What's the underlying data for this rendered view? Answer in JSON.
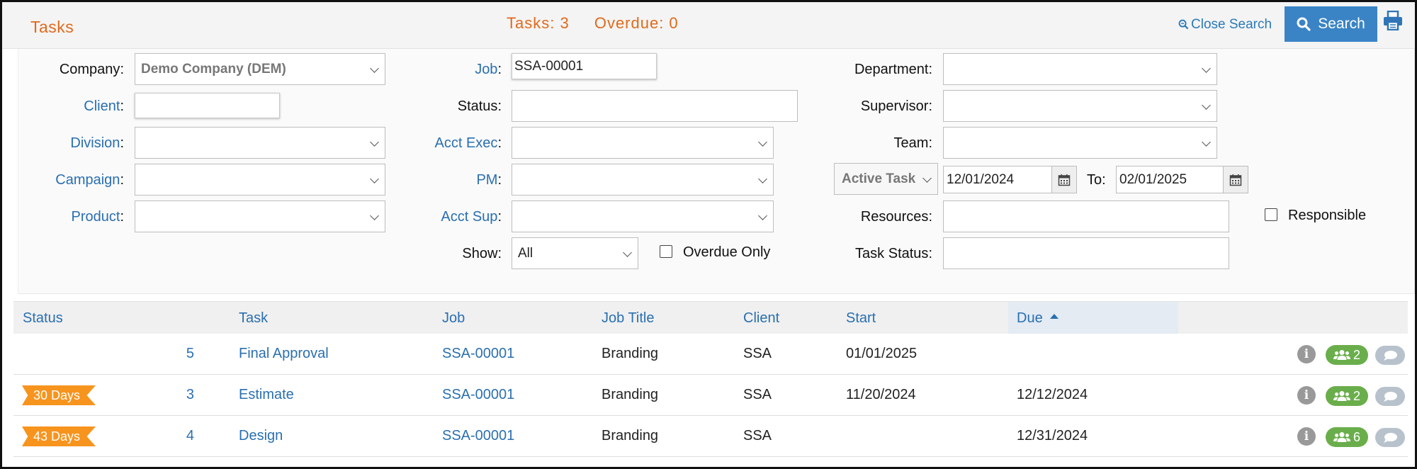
{
  "header": {
    "title": "Tasks",
    "tasks_count": "Tasks: 3",
    "overdue_count": "Overdue: 0",
    "close_search_label": "Close Search",
    "search_label": "Search"
  },
  "form": {
    "company": {
      "label": "Company",
      "value": "Demo Company (DEM)"
    },
    "client": {
      "label": "Client",
      "value": ""
    },
    "division": {
      "label": "Division",
      "value": ""
    },
    "campaign": {
      "label": "Campaign",
      "value": ""
    },
    "product": {
      "label": "Product",
      "value": ""
    },
    "job": {
      "label": "Job",
      "value": "SSA-00001"
    },
    "status": {
      "label": "Status",
      "value": ""
    },
    "acct_exec": {
      "label": "Acct Exec",
      "value": ""
    },
    "pm": {
      "label": "PM",
      "value": ""
    },
    "acct_sup": {
      "label": "Acct Sup",
      "value": ""
    },
    "show": {
      "label": "Show",
      "value": "All"
    },
    "overdue_only": {
      "label": "Overdue Only",
      "checked": false
    },
    "department": {
      "label": "Department",
      "value": ""
    },
    "supervisor": {
      "label": "Supervisor",
      "value": ""
    },
    "team": {
      "label": "Team",
      "value": ""
    },
    "date_type": {
      "value": "Active Task"
    },
    "date_from": {
      "value": "12/01/2024"
    },
    "date_to": {
      "label": "To",
      "value": "02/01/2025"
    },
    "resources": {
      "label": "Resources",
      "value": ""
    },
    "task_status": {
      "label": "Task Status",
      "value": ""
    },
    "responsible": {
      "label": "Responsible",
      "checked": false
    }
  },
  "table": {
    "columns": [
      "Status",
      "Task",
      "Job",
      "Job Title",
      "Client",
      "Start",
      "Due"
    ],
    "sorted_column": "Due",
    "rows": [
      {
        "status_flag": "",
        "number": "5",
        "task": "Final Approval",
        "job": "SSA-00001",
        "job_title": "Branding",
        "client": "SSA",
        "start": "01/01/2025",
        "due": "",
        "team_count": "2"
      },
      {
        "status_flag": "30 Days",
        "number": "3",
        "task": "Estimate",
        "job": "SSA-00001",
        "job_title": "Branding",
        "client": "SSA",
        "start": "11/20/2024",
        "due": "12/12/2024",
        "team_count": "2"
      },
      {
        "status_flag": "43 Days",
        "number": "4",
        "task": "Design",
        "job": "SSA-00001",
        "job_title": "Branding",
        "client": "SSA",
        "start": "",
        "due": "12/31/2024",
        "team_count": "6"
      }
    ]
  },
  "colors": {
    "accent_orange": "#e06a1b",
    "link_blue": "#2a6fb0",
    "search_button": "#3a84c6",
    "flag_orange": "#f7941d",
    "team_green": "#6aae4c"
  },
  "icons": [
    "search-zoom-icon",
    "search-icon",
    "print-icon",
    "calendar-icon",
    "info-icon",
    "users-icon",
    "comment-icon",
    "sort-ascending-icon"
  ]
}
